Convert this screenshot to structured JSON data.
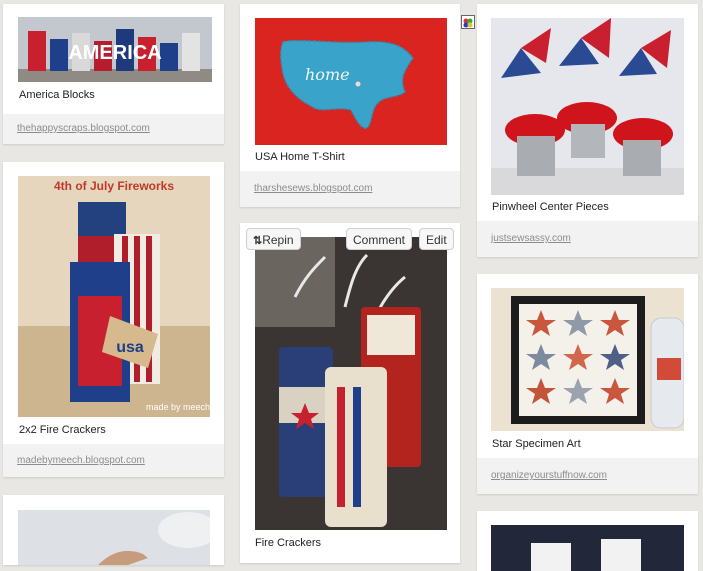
{
  "pins": [
    {
      "caption": "America Blocks",
      "source": "thehappyscraps.blogspot.com"
    },
    {
      "caption": "2x2 Fire Crackers",
      "source": "madebymeech.blogspot.com"
    },
    {
      "caption": "USA Home T-Shirt",
      "source": "tharshesews.blogspot.com"
    },
    {
      "caption": "Fire Crackers",
      "source": ""
    },
    {
      "caption": "Pinwheel Center Pieces",
      "source": "justsewsassy.com"
    },
    {
      "caption": "Star Specimen Art",
      "source": "organizeyourstuffnow.com"
    }
  ],
  "image_text": {
    "america_blocks": "AMERICA",
    "fireworks_title": "4th of July Fireworks",
    "fireworks_tag": "usa",
    "fireworks_credit": "made by meech",
    "shirt_word": "home"
  },
  "actions": {
    "repin": "Repin",
    "comment": "Comment",
    "edit": "Edit"
  },
  "icons": {
    "repin_icon": "repin-icon",
    "extension": "extension-icon"
  },
  "colors": {
    "background": "#e9e7e4",
    "card": "#ffffff",
    "source_bar": "#f2f2f2",
    "link": "#8c8c8c"
  }
}
